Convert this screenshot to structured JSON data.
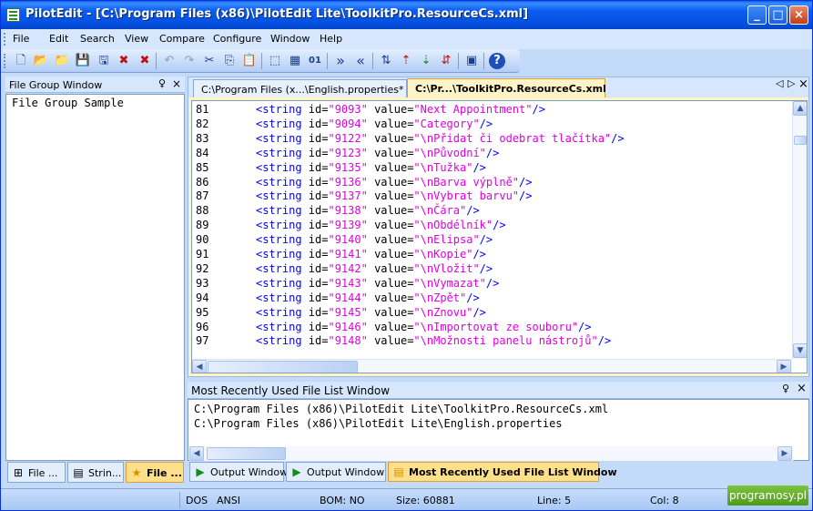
{
  "window": {
    "title": "PilotEdit - [C:\\Program Files (x86)\\PilotEdit Lite\\ToolkitPro.ResourceCs.xml]",
    "controls": {
      "minimize": "_",
      "maximize": "□",
      "close": "×"
    }
  },
  "menu": [
    "File",
    "Edit",
    "Search",
    "View",
    "Compare",
    "Configure",
    "Window",
    "Help"
  ],
  "toolbar": {
    "icons": [
      "new-file-icon",
      "open-file-icon",
      "open-folder-icon",
      "save-icon",
      "save-all-icon",
      "close-icon",
      "close-all-icon",
      "undo-icon",
      "redo-icon",
      "cut-icon",
      "copy-icon",
      "paste-icon",
      "select-icon",
      "column-mode-icon",
      "hex-icon",
      "indent-icon",
      "outdent-icon",
      "ftp-icon",
      "ftp-upload-icon",
      "ftp-download-icon",
      "ftp-disconnect-icon",
      "block-icon",
      "help-icon"
    ],
    "glyphs": [
      "🗋",
      "📂",
      "📁",
      "💾",
      "🖫",
      "✖",
      "✖",
      "↶",
      "↷",
      "✂",
      "⎘",
      "📋",
      "⬚",
      "▦",
      "01",
      "»",
      "«",
      "⇅",
      "⇡",
      "⇣",
      "⇵",
      "▣",
      "?"
    ]
  },
  "left_panel": {
    "title": "File Group Window",
    "pin": "♀",
    "close": "×",
    "items": [
      "File Group Sample"
    ],
    "tabs": [
      {
        "label": "File ...",
        "icon": "⊞",
        "active": false
      },
      {
        "label": "Strin...",
        "icon": "▤",
        "active": false
      },
      {
        "label": "File ...",
        "icon": "★",
        "active": true
      }
    ]
  },
  "editor": {
    "tabs": [
      {
        "label": "C:\\Program Files (x...\\English.properties*",
        "active": false
      },
      {
        "label": "C:\\Pr...\\ToolkitPro.ResourceCs.xml",
        "active": true
      }
    ],
    "nav": {
      "prev": "◁",
      "next": "▷",
      "close": "×"
    },
    "lines": [
      {
        "n": "81",
        "id": "9093",
        "value": "Next Appointment"
      },
      {
        "n": "82",
        "id": "9094",
        "value": "Category"
      },
      {
        "n": "83",
        "id": "9122",
        "value": "\\nPřidat či odebrat tlačítka"
      },
      {
        "n": "84",
        "id": "9123",
        "value": "\\nPůvodní"
      },
      {
        "n": "85",
        "id": "9135",
        "value": "\\nTužka"
      },
      {
        "n": "86",
        "id": "9136",
        "value": "\\nBarva výplně"
      },
      {
        "n": "87",
        "id": "9137",
        "value": "\\nVybrat barvu"
      },
      {
        "n": "88",
        "id": "9138",
        "value": "\\nČára"
      },
      {
        "n": "89",
        "id": "9139",
        "value": "\\nObdélník"
      },
      {
        "n": "90",
        "id": "9140",
        "value": "\\nElipsa"
      },
      {
        "n": "91",
        "id": "9141",
        "value": "\\nKopie"
      },
      {
        "n": "92",
        "id": "9142",
        "value": "\\nVložit"
      },
      {
        "n": "93",
        "id": "9143",
        "value": "\\nVymazat"
      },
      {
        "n": "94",
        "id": "9144",
        "value": "\\nZpět"
      },
      {
        "n": "95",
        "id": "9145",
        "value": "\\nZnovu"
      },
      {
        "n": "96",
        "id": "9146",
        "value": "\\nImportovat ze souboru"
      },
      {
        "n": "97",
        "id": "9148",
        "value": "\\nMožnosti panelu nástrojů"
      }
    ],
    "tag_open": "<string",
    "attr_id": " id=",
    "attr_value": " value=",
    "tag_close": "/>"
  },
  "mru": {
    "title": "Most Recently Used File List Window",
    "pin": "♀",
    "close": "×",
    "items": [
      "C:\\Program Files (x86)\\PilotEdit Lite\\ToolkitPro.ResourceCs.xml",
      "C:\\Program Files (x86)\\PilotEdit Lite\\English.properties"
    ]
  },
  "bottom_tabs": [
    {
      "label": "Output Window",
      "icon": "▶",
      "active": false
    },
    {
      "label": "Output Window 2",
      "icon": "▶",
      "active": false
    },
    {
      "label": "Most Recently Used File List Window",
      "icon": "▤",
      "active": true
    }
  ],
  "status": {
    "eol": "DOS",
    "encoding": "ANSI",
    "bom": "BOM: NO",
    "size": "Size: 60881",
    "line": "Line: 5",
    "col": "Col: 8"
  },
  "watermark": "programosy.pl",
  "colors": {
    "tag": "#0000ff",
    "value": "#E000E0",
    "titlebar": "#0550E0",
    "active_tab": "#FFE08A"
  }
}
